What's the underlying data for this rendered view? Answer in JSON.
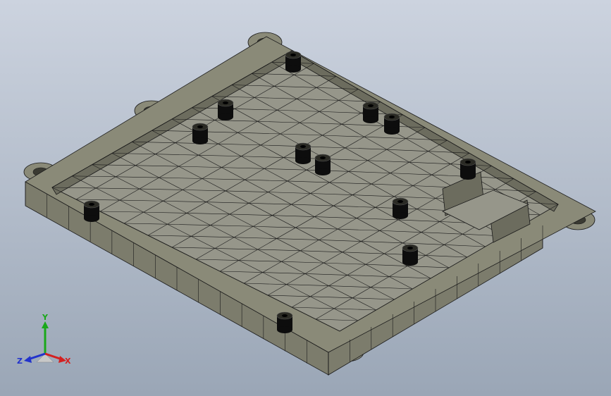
{
  "viewport": {
    "background_top": "#ccd3df",
    "background_bottom": "#9aa6b6",
    "model_fill": "#8a8a78",
    "model_edge": "#1a1a1a",
    "boss_fill": "#0d0d0d"
  },
  "triad": {
    "x_label": "X",
    "y_label": "Y",
    "z_label": "Z",
    "x_color": "#d42020",
    "y_color": "#1aa81a",
    "z_color": "#2233cc"
  }
}
